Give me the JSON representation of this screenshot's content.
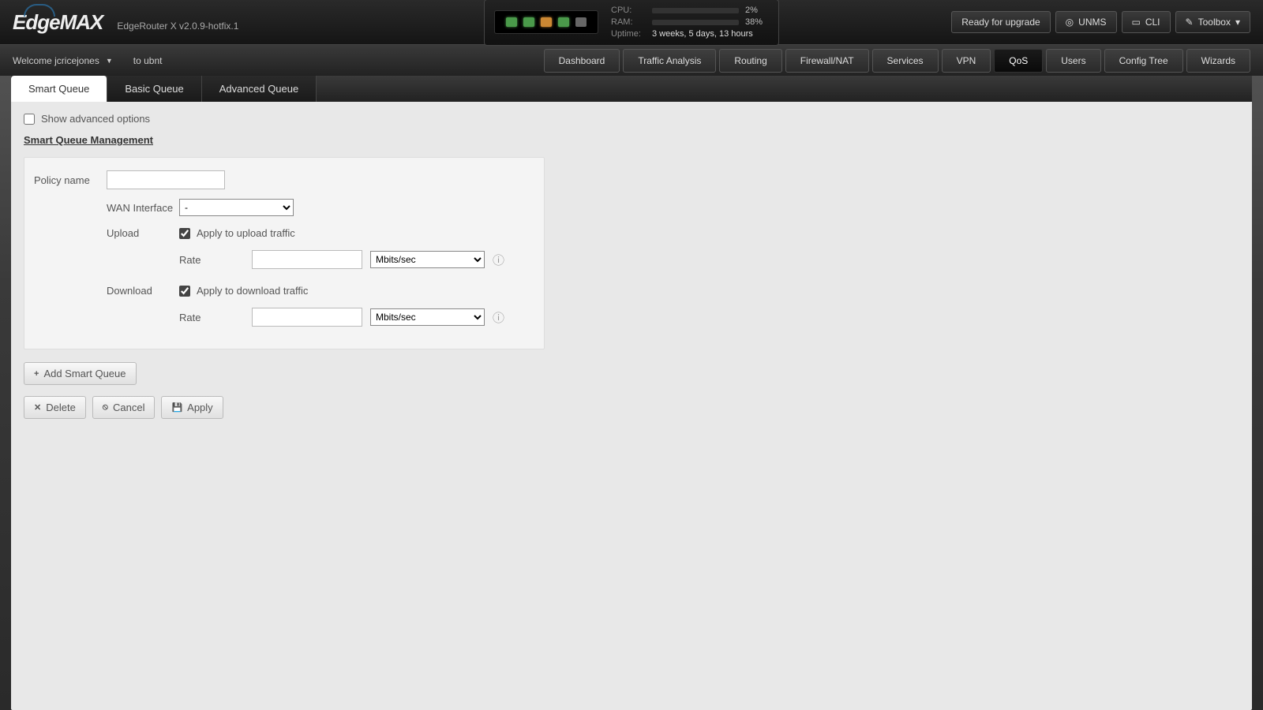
{
  "brand": {
    "name": "EdgeMAX",
    "model": "EdgeRouter X v2.0.9-hotfix.1"
  },
  "status": {
    "cpu_label": "CPU:",
    "cpu_pct": 2,
    "cpu_text": "2%",
    "ram_label": "RAM:",
    "ram_pct": 38,
    "ram_text": "38%",
    "uptime_label": "Uptime:",
    "uptime_text": "3 weeks, 5 days, 13 hours"
  },
  "topbar": {
    "upgrade": "Ready for upgrade",
    "unms": "UNMS",
    "cli": "CLI",
    "toolbox": "Toolbox"
  },
  "nav": {
    "welcome": "Welcome jcricejones",
    "to": "to ubnt",
    "tabs": [
      "Dashboard",
      "Traffic Analysis",
      "Routing",
      "Firewall/NAT",
      "Services",
      "VPN",
      "QoS",
      "Users",
      "Config Tree",
      "Wizards"
    ],
    "active_index": 6
  },
  "subtabs": {
    "items": [
      "Smart Queue",
      "Basic Queue",
      "Advanced Queue"
    ],
    "active_index": 0
  },
  "form": {
    "show_adv_label": "Show advanced options",
    "section_title": "Smart Queue Management",
    "policy_name_label": "Policy name",
    "policy_name_value": "",
    "wan_label": "WAN Interface",
    "wan_selected": "-",
    "upload_label": "Upload",
    "upload_apply_label": "Apply to upload traffic",
    "rate_label": "Rate",
    "upload_rate_value": "",
    "rate_unit": "Mbits/sec",
    "download_label": "Download",
    "download_apply_label": "Apply to download traffic",
    "download_rate_value": ""
  },
  "buttons": {
    "add": "Add Smart Queue",
    "delete": "Delete",
    "cancel": "Cancel",
    "apply": "Apply"
  }
}
